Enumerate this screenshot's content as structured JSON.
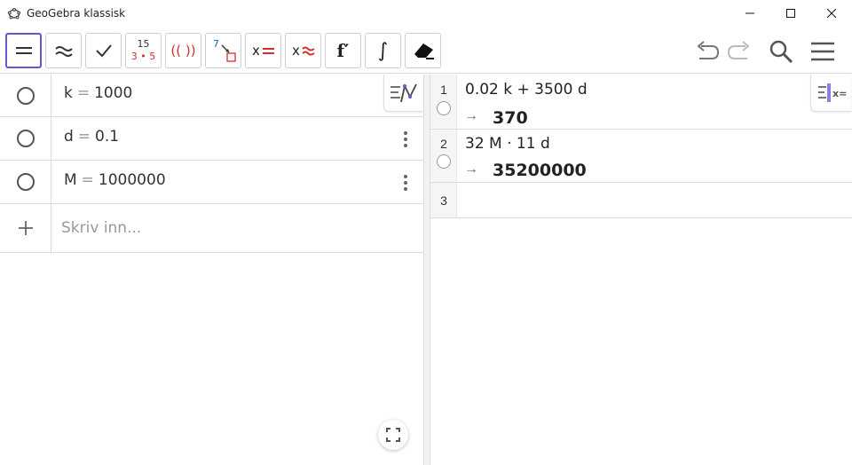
{
  "window": {
    "title": "GeoGebra klassisk"
  },
  "toolbar": {
    "tools": [
      {
        "name": "evaluate",
        "icon": "equals-icon"
      },
      {
        "name": "numeric",
        "icon": "approx-icon"
      },
      {
        "name": "keep-input",
        "icon": "check-icon"
      },
      {
        "name": "factor",
        "icon": "factor-icon",
        "top": "15",
        "bottom": "3 • 5"
      },
      {
        "name": "expand",
        "icon": "expand-icon",
        "text": "(( ))"
      },
      {
        "name": "substitute",
        "icon": "substitute-icon",
        "text": "7"
      },
      {
        "name": "solve",
        "icon": "solve-icon",
        "text": "x="
      },
      {
        "name": "solve-numerically",
        "icon": "nsolve-icon",
        "text": "x≈"
      },
      {
        "name": "derivative",
        "icon": "derivative-icon",
        "text": "f′"
      },
      {
        "name": "integral",
        "icon": "integral-icon",
        "text": "∫"
      },
      {
        "name": "delete",
        "icon": "eraser-icon"
      }
    ],
    "right": [
      "undo-icon",
      "redo-icon",
      "search-icon",
      "menu-icon"
    ]
  },
  "algebra": {
    "rows": [
      {
        "var": "k",
        "eq": "=",
        "value": "1000"
      },
      {
        "var": "d",
        "eq": "=",
        "value": "0.1"
      },
      {
        "var": "M",
        "eq": "=",
        "value": "1000000"
      }
    ],
    "input_placeholder": "Skriv inn..."
  },
  "cas": {
    "rows": [
      {
        "num": "1",
        "input": "0.02 k + 3500 d",
        "arrow": "→",
        "output": "370"
      },
      {
        "num": "2",
        "input": "32 M · 11 d",
        "arrow": "→",
        "output": "35200000"
      },
      {
        "num": "3",
        "input": "",
        "arrow": "",
        "output": ""
      }
    ]
  },
  "colors": {
    "accent": "#6557d2",
    "red": "#d32f2f",
    "blue": "#1565c0"
  }
}
